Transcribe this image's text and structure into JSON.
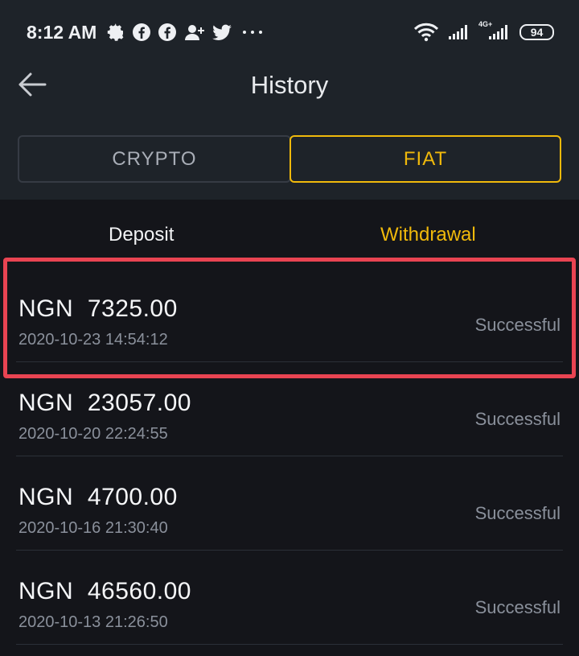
{
  "status_bar": {
    "time": "8:12 AM",
    "icons": [
      "gear-icon",
      "facebook-icon",
      "facebook-icon",
      "person-add-icon",
      "twitter-icon",
      "more-icon"
    ],
    "signal_label": "4G+",
    "battery": "94"
  },
  "header": {
    "title": "History"
  },
  "tabs": {
    "crypto": "CRYPTO",
    "fiat": "FIAT",
    "active": "FIAT"
  },
  "subtabs": {
    "deposit": "Deposit",
    "withdrawal": "Withdrawal",
    "active": "Withdrawal"
  },
  "transactions": [
    {
      "currency": "NGN",
      "amount": "7325.00",
      "datetime": "2020-10-23 14:54:12",
      "status": "Successful"
    },
    {
      "currency": "NGN",
      "amount": "23057.00",
      "datetime": "2020-10-20 22:24:55",
      "status": "Successful"
    },
    {
      "currency": "NGN",
      "amount": "4700.00",
      "datetime": "2020-10-16 21:30:40",
      "status": "Successful"
    },
    {
      "currency": "NGN",
      "amount": "46560.00",
      "datetime": "2020-10-13 21:26:50",
      "status": "Successful"
    }
  ],
  "colors": {
    "accent": "#f0b90b",
    "highlight": "#e94452",
    "header_bg": "#1e2329",
    "list_bg": "#14151a"
  }
}
